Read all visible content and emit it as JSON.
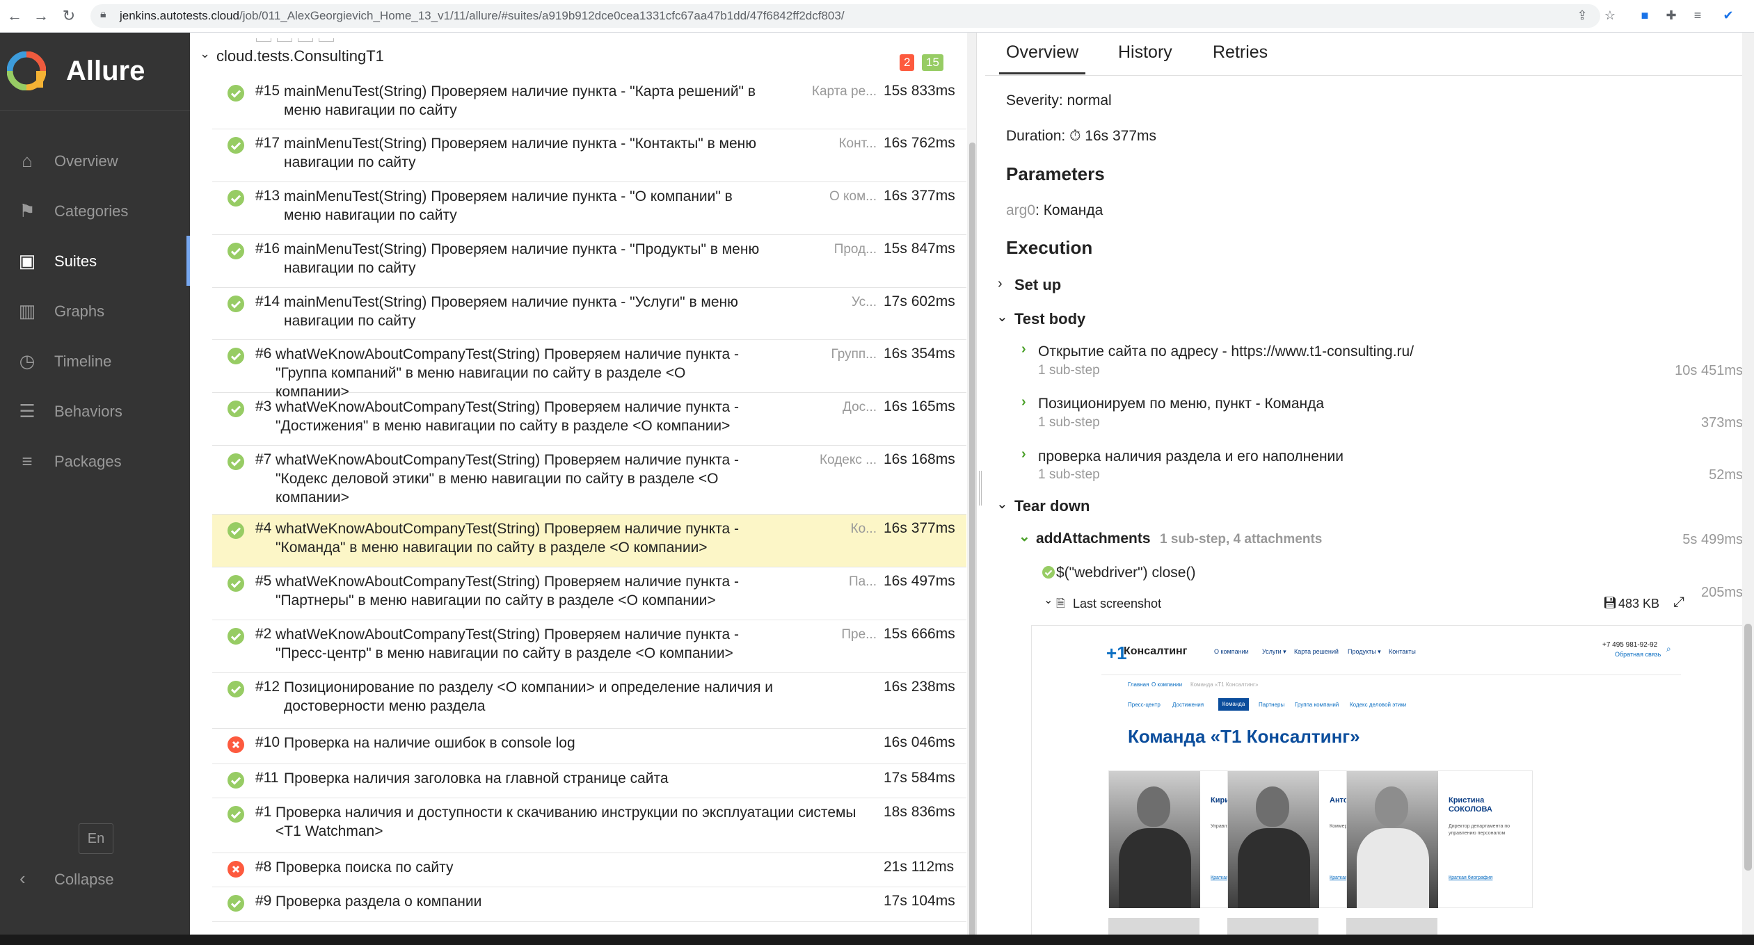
{
  "browser": {
    "url_domain": "jenkins.autotests.cloud",
    "url_path": "/job/011_AlexGeorgievich_Home_13_v1/11/allure/#suites/a919b912dce0cea1331cfc67aa47b1dd/47f6842ff2dcf803/"
  },
  "sidebar": {
    "brand": "Allure",
    "items": [
      {
        "label": "Overview",
        "icon": "home-icon"
      },
      {
        "label": "Categories",
        "icon": "flag-icon"
      },
      {
        "label": "Suites",
        "icon": "briefcase-icon",
        "active": true
      },
      {
        "label": "Graphs",
        "icon": "bar-chart-icon"
      },
      {
        "label": "Timeline",
        "icon": "clock-icon"
      },
      {
        "label": "Behaviors",
        "icon": "list-icon"
      },
      {
        "label": "Packages",
        "icon": "align-left-icon"
      }
    ],
    "language": "En",
    "collapse": "Collapse"
  },
  "suite": {
    "name": "cloud.tests.ConsultingT1",
    "failed_count": "2",
    "passed_count": "15",
    "tests": [
      {
        "status": "passed",
        "num": "#15",
        "name": "mainMenuTest(String) Проверяем наличие пункта - \"Карта решений\" в меню навигации по сайту",
        "param": "Карта ре...",
        "duration": "15s 833ms"
      },
      {
        "status": "passed",
        "num": "#17",
        "name": "mainMenuTest(String) Проверяем наличие пункта - \"Контакты\" в меню навигации по сайту",
        "param": "Конт...",
        "duration": "16s 762ms"
      },
      {
        "status": "passed",
        "num": "#13",
        "name": "mainMenuTest(String) Проверяем наличие пункта - \"О компании\" в меню навигации по сайту",
        "param": "О ком...",
        "duration": "16s 377ms"
      },
      {
        "status": "passed",
        "num": "#16",
        "name": "mainMenuTest(String) Проверяем наличие пункта - \"Продукты\" в меню навигации по сайту",
        "param": "Прод...",
        "duration": "15s 847ms"
      },
      {
        "status": "passed",
        "num": "#14",
        "name": "mainMenuTest(String) Проверяем наличие пункта - \"Услуги\" в меню навигации по сайту",
        "param": "Ус...",
        "duration": "17s 602ms"
      },
      {
        "status": "passed",
        "num": "#6",
        "name": "whatWeKnowAboutCompanyTest(String) Проверяем наличие пункта - \"Группа компаний\" в меню навигации по сайту в разделе <О компании>",
        "param": "Групп...",
        "duration": "16s 354ms"
      },
      {
        "status": "passed",
        "num": "#3",
        "name": "whatWeKnowAboutCompanyTest(String) Проверяем наличие пункта - \"Достижения\" в меню навигации по сайту в разделе <О компании>",
        "param": "Дос...",
        "duration": "16s 165ms"
      },
      {
        "status": "passed",
        "num": "#7",
        "name": "whatWeKnowAboutCompanyTest(String) Проверяем наличие пункта - \"Кодекс деловой этики\" в меню навигации по сайту в разделе <О компании>",
        "param": "Кодекс ...",
        "duration": "16s 168ms"
      },
      {
        "status": "passed",
        "num": "#4",
        "name": "whatWeKnowAboutCompanyTest(String) Проверяем наличие пункта - \"Команда\" в меню навигации по сайту в разделе <О компании>",
        "param": "Ко...",
        "duration": "16s 377ms",
        "selected": true
      },
      {
        "status": "passed",
        "num": "#5",
        "name": "whatWeKnowAboutCompanyTest(String) Проверяем наличие пункта - \"Партнеры\" в меню навигации по сайту в разделе <О компании>",
        "param": "Па...",
        "duration": "16s 497ms"
      },
      {
        "status": "passed",
        "num": "#2",
        "name": "whatWeKnowAboutCompanyTest(String) Проверяем наличие пункта - \"Пресс-центр\" в меню навигации по сайту в разделе <О компании>",
        "param": "Пре...",
        "duration": "15s 666ms"
      },
      {
        "status": "passed",
        "num": "#12",
        "name": "Позиционирование по разделу <О компании> и определение наличия и достоверности меню раздела",
        "param": "",
        "duration": "16s 238ms"
      },
      {
        "status": "failed",
        "num": "#10",
        "name": "Проверка на наличие ошибок в console log",
        "param": "",
        "duration": "16s 046ms"
      },
      {
        "status": "passed",
        "num": "#11",
        "name": "Проверка наличия заголовка на главной странице сайта",
        "param": "",
        "duration": "17s 584ms"
      },
      {
        "status": "passed",
        "num": "#1",
        "name": "Проверка наличия и доступности к скачиванию инструкции по эксплуатации системы <T1 Watchman>",
        "param": "",
        "duration": "18s 836ms"
      },
      {
        "status": "failed",
        "num": "#8",
        "name": "Проверка поиска по сайту",
        "param": "",
        "duration": "21s 112ms"
      },
      {
        "status": "passed",
        "num": "#9",
        "name": "Проверка раздела о компании",
        "param": "",
        "duration": "17s 104ms"
      }
    ]
  },
  "detail": {
    "tabs": [
      "Overview",
      "History",
      "Retries"
    ],
    "severity": "Severity: normal",
    "duration_label": "Duration:",
    "duration_value": "16s 377ms",
    "parameters_heading": "Parameters",
    "param_key": "arg0",
    "param_value": ": Команда",
    "execution_heading": "Execution",
    "setup": "Set up",
    "test_body": "Test body",
    "steps": [
      {
        "title": "Открытие сайта по адресу - https://www.t1-consulting.ru/",
        "sub": "1 sub-step",
        "duration": "10s 451ms"
      },
      {
        "title": "Позиционируем по меню, пункт - Команда",
        "sub": "1 sub-step",
        "duration": "373ms"
      },
      {
        "title": "проверка наличия раздела и его наполнении",
        "sub": "1 sub-step",
        "duration": "52ms"
      }
    ],
    "teardown": "Tear down",
    "add_attachments": "addAttachments",
    "add_attachments_meta": "1 sub-step, 4 attachments",
    "add_attachments_duration": "5s 499ms",
    "close_step": "$(\"webdriver\") close()",
    "close_duration": "205ms",
    "attachment_name": "Last screenshot",
    "attachment_size": "483 KB"
  },
  "screenshot": {
    "logo": "Консалтинг",
    "nav": [
      "О компании",
      "Услуги ▾",
      "Карта решений",
      "Продукты ▾",
      "Контакты"
    ],
    "phone": "+7 495 981-92-92",
    "feedback": "Обратная связь",
    "breadcrumbs": [
      "Главная",
      "О компании",
      "Команда «Т1 Консалтинг»"
    ],
    "subnav": [
      "Пресс-центр",
      "Достижения",
      "Команда",
      "Партнеры",
      "Группа компаний",
      "Кодекс деловой этики"
    ],
    "title": "Команда «Т1 Консалтинг»",
    "people": [
      {
        "name": "Кирилл БУЛГАКОВ",
        "role": "Управляющий директор",
        "bio": "Краткая биография"
      },
      {
        "name": "Антон СПИРИН",
        "role": "Коммерческий директор",
        "bio": "Краткая биография"
      },
      {
        "name": "Кристина СОКОЛОВА",
        "role": "Директор департамента по управлению персоналом",
        "bio": "Краткая биография"
      }
    ]
  }
}
